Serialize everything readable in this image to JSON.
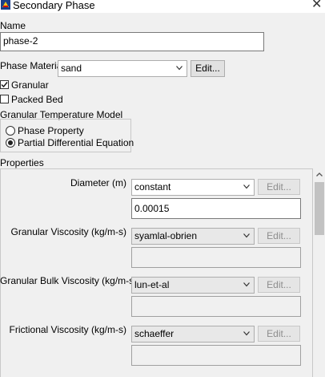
{
  "window": {
    "title": "Secondary Phase",
    "close_glyph": "✕"
  },
  "name_section": {
    "label": "Name",
    "value": "phase-2"
  },
  "phase_material": {
    "label": "Phase Material",
    "selected": "sand",
    "edit_label": "Edit..."
  },
  "options": {
    "granular": {
      "label": "Granular",
      "checked": true
    },
    "packed_bed": {
      "label": "Packed Bed",
      "checked": false
    }
  },
  "granular_temperature_model": {
    "label": "Granular Temperature Model",
    "options": [
      {
        "label": "Phase Property",
        "selected": false
      },
      {
        "label": "Partial Differential Equation",
        "selected": true
      }
    ]
  },
  "properties": {
    "label": "Properties",
    "rows": [
      {
        "label": "Diameter (m)",
        "method": "constant",
        "edit_label": "Edit...",
        "value": "0.00015"
      },
      {
        "label": "Granular Viscosity (kg/m-s)",
        "method": "syamlal-obrien",
        "edit_label": "Edit...",
        "value": ""
      },
      {
        "label": "Granular Bulk Viscosity (kg/m-s)",
        "method": "lun-et-al",
        "edit_label": "Edit...",
        "value": ""
      },
      {
        "label": "Frictional Viscosity (kg/m-s)",
        "method": "schaeffer",
        "edit_label": "Edit...",
        "value": ""
      }
    ]
  },
  "icons": {
    "app": "ansys-fluent-icon",
    "close": "close-icon",
    "dropdown": "chevron-down-icon",
    "scroll_up": "scroll-up-arrow-icon"
  }
}
